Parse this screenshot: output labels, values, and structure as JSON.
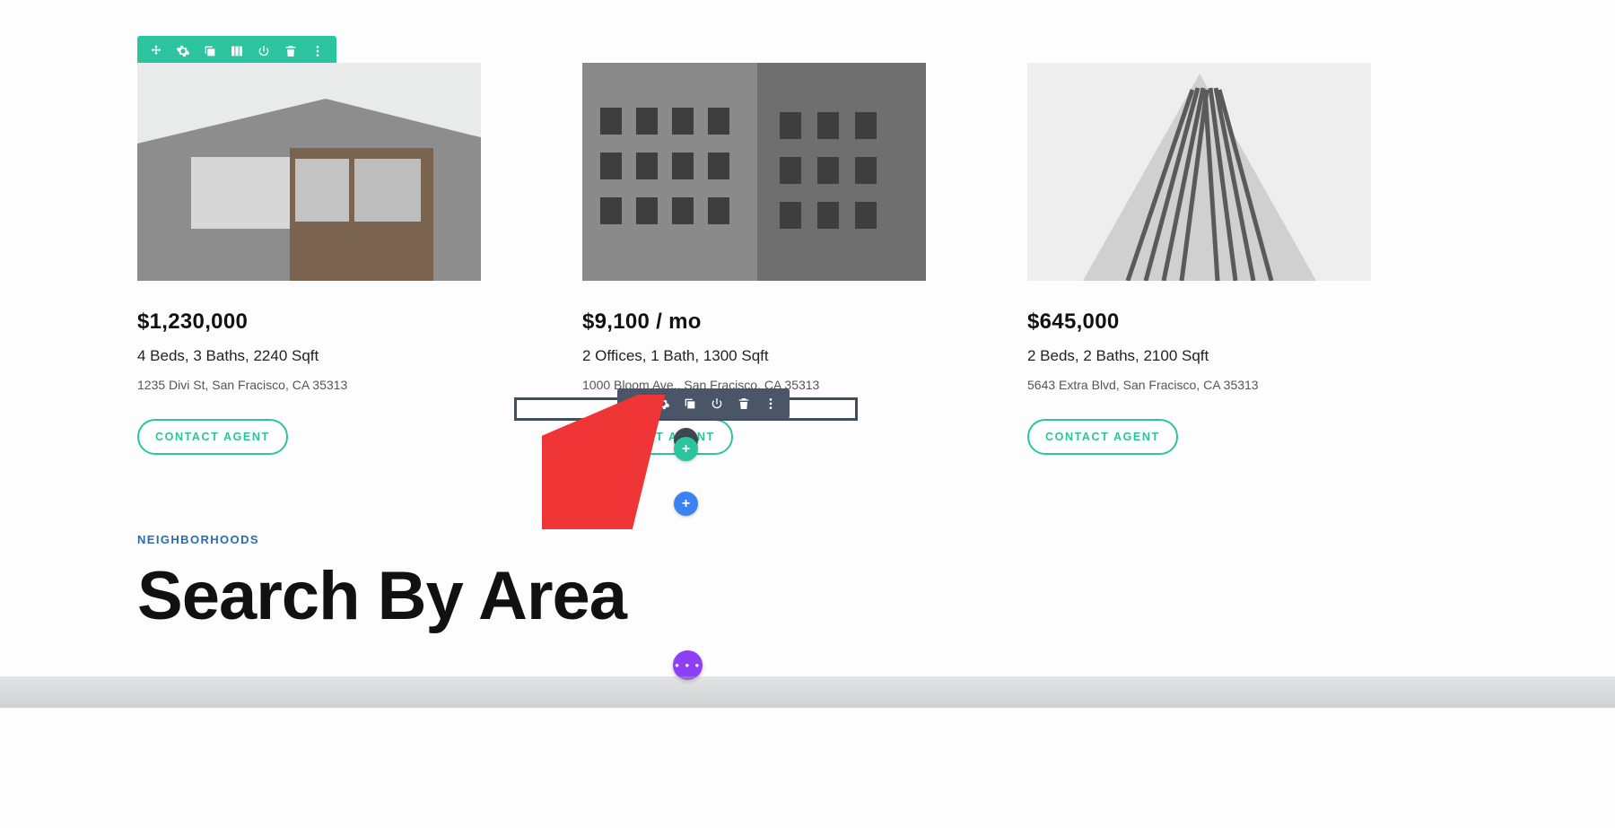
{
  "colors": {
    "teal": "#2cc49e",
    "dark": "#4a5568",
    "purple": "#8e3ff7",
    "blue": "#2b6cb0",
    "addblue": "#3b82f6"
  },
  "toolbar": {
    "icons": [
      "move",
      "gear",
      "duplicate",
      "columns",
      "power",
      "trash",
      "kebab"
    ]
  },
  "listings": [
    {
      "image_alt": "modern-house",
      "price": "$1,230,000",
      "specs": "4 Beds, 3 Baths, 2240 Sqft",
      "address": "1235 Divi St, San Fracisco, CA 35313",
      "cta": "CONTACT AGENT"
    },
    {
      "image_alt": "ornate-building-corner",
      "price": "$9,100 / mo",
      "specs": "2 Offices, 1 Bath, 1300 Sqft",
      "address": "1000 Bloom Ave., San Fracisco, CA 35313",
      "cta": "CONTACT AGENT"
    },
    {
      "image_alt": "skyscraper",
      "price": "$645,000",
      "specs": "2 Beds, 2 Baths, 2100 Sqft",
      "address": "5643 Extra Blvd, San Fracisco, CA 35313",
      "cta": "CONTACT AGENT"
    }
  ],
  "section": {
    "eyebrow": "NEIGHBORHOODS",
    "title": "Search By Area"
  },
  "add": {
    "plus": "+"
  },
  "fab": {
    "dots": "• • •"
  }
}
